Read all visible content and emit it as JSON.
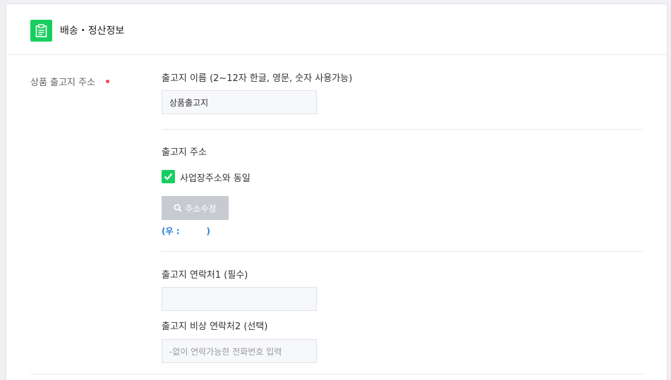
{
  "header": {
    "title": "배송・정산정보",
    "icon": "clipboard-icon",
    "accent": "#19ce60"
  },
  "section": {
    "label": "상품 출고지 주소",
    "required_color": "#f5455a"
  },
  "warehouse_name": {
    "label": "출고지 이름 (2~12자 한글, 영문, 숫자 사용가능)",
    "value": "상품출고지"
  },
  "warehouse_address": {
    "label": "출고지 주소",
    "same_as_business_label": "사업장주소와 동일",
    "same_as_business_checked": true,
    "edit_button_label": "주소수정",
    "postal_prefix": "(우 :",
    "postal_suffix": ")"
  },
  "contact1": {
    "label": "출고지 연락처1 (필수)",
    "value": ""
  },
  "contact2": {
    "label": "출고지 비상 연락처2 (선택)",
    "placeholder": "-없이 연락가능한 전화번호 입력"
  }
}
